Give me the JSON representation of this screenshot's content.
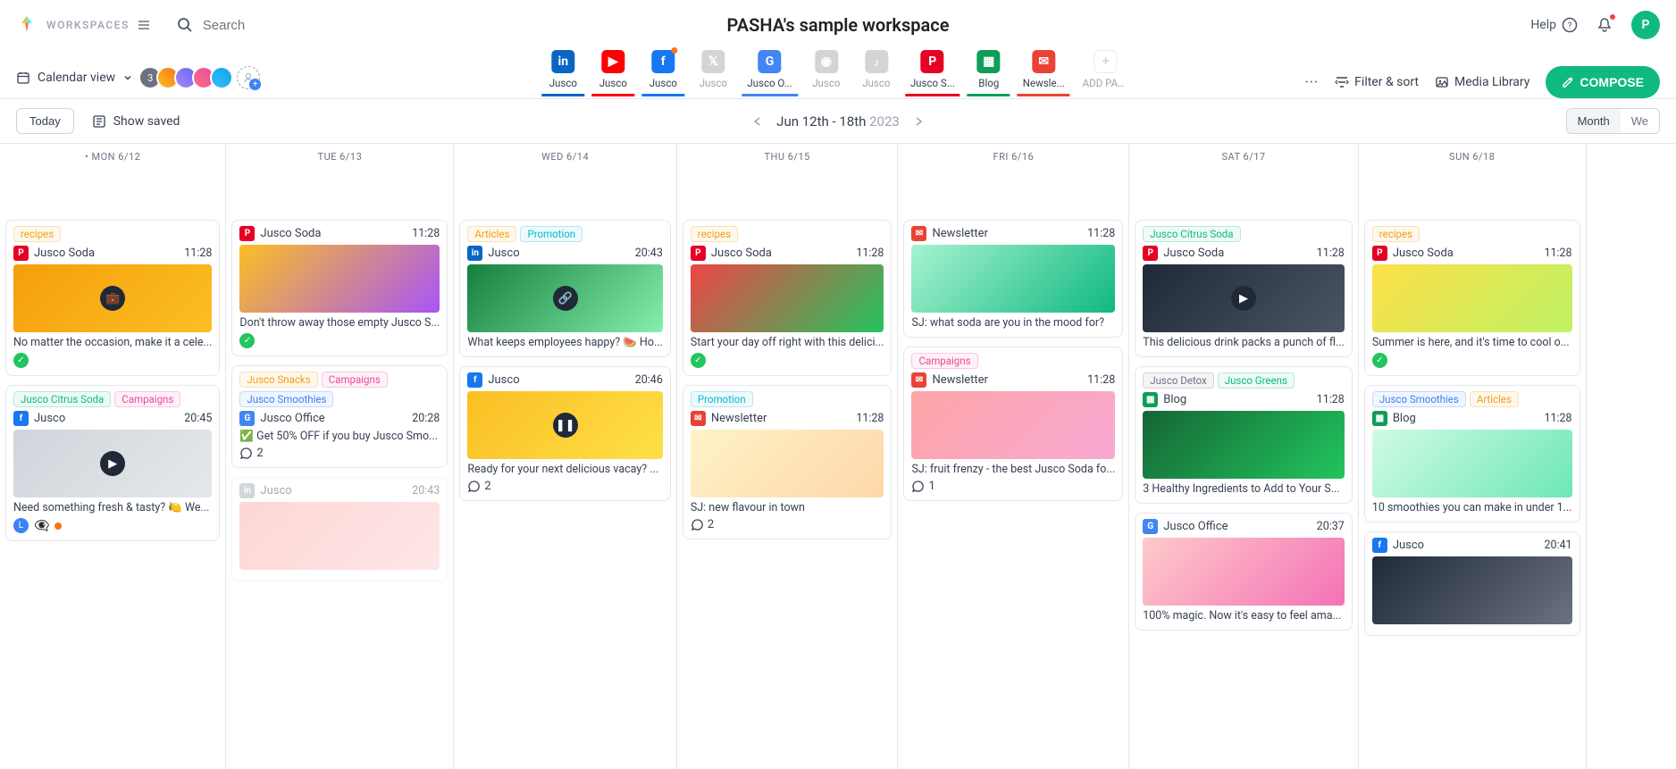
{
  "header": {
    "workspaces_label": "WORKSPACES",
    "search_placeholder": "Search",
    "title": "PASHA's sample workspace",
    "help_label": "Help",
    "avatar_initial": "P"
  },
  "toolbar": {
    "view_label": "Calendar view",
    "avatar_count": "3",
    "filter_sort": "Filter & sort",
    "media_library": "Media Library",
    "compose": "COMPOSE",
    "add_pages": "ADD PAGES"
  },
  "pages": [
    {
      "label": "Jusco",
      "network": "linkedin",
      "color": "#0a66c2",
      "active": true
    },
    {
      "label": "Jusco",
      "network": "youtube",
      "color": "#ff0000",
      "active": true
    },
    {
      "label": "Jusco",
      "network": "facebook",
      "color": "#1877f2",
      "active": true,
      "dot": true
    },
    {
      "label": "Jusco",
      "network": "twitter",
      "color": "#9ca3af",
      "active": false
    },
    {
      "label": "Jusco O...",
      "network": "google",
      "color": "#4285f4",
      "active": true
    },
    {
      "label": "Jusco",
      "network": "instagram",
      "color": "#9ca3af",
      "active": false
    },
    {
      "label": "Jusco",
      "network": "tiktok",
      "color": "#9ca3af",
      "active": false
    },
    {
      "label": "Jusco S...",
      "network": "pinterest",
      "color": "#e60023",
      "active": true
    },
    {
      "label": "Blog",
      "network": "sheets",
      "color": "#0f9d58",
      "active": true
    },
    {
      "label": "Newsle...",
      "network": "gmail",
      "color": "#ea4335",
      "active": true
    }
  ],
  "subbar": {
    "today": "Today",
    "show_saved": "Show saved",
    "date_range": "Jun 12th - 18th",
    "year": "2023",
    "month_label": "Month",
    "week_label": "We"
  },
  "days": [
    {
      "label": "MON 6/12",
      "today": true
    },
    {
      "label": "TUE 6/13"
    },
    {
      "label": "WED 6/14"
    },
    {
      "label": "THU 6/15"
    },
    {
      "label": "FRI 6/16"
    },
    {
      "label": "SAT 6/17"
    },
    {
      "label": "SUN 6/18"
    }
  ],
  "cards": {
    "mon": [
      {
        "tags": [
          {
            "t": "recipes",
            "c": "#f59e0b"
          }
        ],
        "icon": "pinterest",
        "icolor": "#e60023",
        "source": "Jusco Soda",
        "time": "11:28",
        "thumb": "linear-gradient(135deg,#f59e0b,#fbbf24)",
        "overlay": "briefcase",
        "text": "No matter the occasion, make it a cele...",
        "status": "check"
      },
      {
        "tags": [
          {
            "t": "Jusco Citrus Soda",
            "c": "#10b981"
          },
          {
            "t": "Campaigns",
            "c": "#ec4899"
          }
        ],
        "icon": "facebook",
        "icolor": "#1877f2",
        "source": "Jusco",
        "time": "20:45",
        "thumb": "linear-gradient(135deg,#d1d5db,#e5e7eb)",
        "overlay": "play",
        "text": "Need something fresh & tasty? 🍋 We...",
        "icons_row": [
          "L",
          "eye",
          "dot"
        ]
      }
    ],
    "tue": [
      {
        "tags": [],
        "icon": "pinterest",
        "icolor": "#e60023",
        "source": "Jusco Soda",
        "time": "11:28",
        "thumb": "linear-gradient(135deg,#fbbf24,#a855f7)",
        "text": "Don't throw away those empty Jusco S...",
        "status": "check"
      },
      {
        "tags": [
          {
            "t": "Jusco Snacks",
            "c": "#f59e0b"
          },
          {
            "t": "Campaigns",
            "c": "#ec4899"
          },
          {
            "t": "Jusco Smoothies",
            "c": "#3b82f6"
          }
        ],
        "icon": "google",
        "icolor": "#4285f4",
        "source": "Jusco Office",
        "time": "20:28",
        "text": "✅ Get 50% OFF if you buy Jusco Smo...",
        "comments": "2"
      },
      {
        "faded": true,
        "tags": [],
        "icon": "linkedin",
        "icolor": "#9ca3af",
        "source": "Jusco",
        "time": "20:43",
        "thumb": "linear-gradient(135deg,#fca5a5,#fecaca)"
      }
    ],
    "wed": [
      {
        "tags": [
          {
            "t": "Articles",
            "c": "#f59e0b"
          },
          {
            "t": "Promotion",
            "c": "#06b6d4"
          }
        ],
        "icon": "linkedin",
        "icolor": "#0a66c2",
        "source": "Jusco",
        "time": "20:43",
        "thumb": "linear-gradient(135deg,#15803d,#86efac)",
        "overlay": "link",
        "text": "What keeps employees happy? 🍉 Ho..."
      },
      {
        "tags": [],
        "icon": "facebook",
        "icolor": "#1877f2",
        "source": "Jusco",
        "time": "20:46",
        "thumb": "linear-gradient(135deg,#fbbf24,#fde047)",
        "overlay": "pause",
        "text": "Ready for your next delicious vacay? ...",
        "comments": "2"
      }
    ],
    "thu": [
      {
        "tags": [
          {
            "t": "recipes",
            "c": "#f59e0b"
          }
        ],
        "icon": "pinterest",
        "icolor": "#e60023",
        "source": "Jusco Soda",
        "time": "11:28",
        "thumb": "linear-gradient(135deg,#ef4444,#22c55e)",
        "text": "Start your day off right with this delici...",
        "status": "check"
      },
      {
        "tags": [
          {
            "t": "Promotion",
            "c": "#06b6d4"
          }
        ],
        "icon": "gmail",
        "icolor": "#ea4335",
        "source": "Newsletter",
        "time": "11:28",
        "thumb": "linear-gradient(135deg,#fef3c7,#fed7aa)",
        "text": "SJ: new flavour in town",
        "comments": "2"
      }
    ],
    "fri": [
      {
        "tags": [],
        "icon": "gmail",
        "icolor": "#ea4335",
        "source": "Newsletter",
        "time": "11:28",
        "thumb": "linear-gradient(135deg,#a7f3d0,#10b981)",
        "text": "SJ: what soda are you in the mood for?"
      },
      {
        "tags": [
          {
            "t": "Campaigns",
            "c": "#ec4899"
          }
        ],
        "icon": "gmail",
        "icolor": "#ea4335",
        "source": "Newsletter",
        "time": "11:28",
        "thumb": "linear-gradient(135deg,#fca5a5,#f9a8d4)",
        "text": "SJ: fruit frenzy - the best Jusco Soda fo...",
        "comments": "1"
      }
    ],
    "sat": [
      {
        "tags": [
          {
            "t": "Jusco Citrus Soda",
            "c": "#10b981"
          }
        ],
        "icon": "pinterest",
        "icolor": "#e60023",
        "source": "Jusco Soda",
        "time": "11:28",
        "thumb": "linear-gradient(135deg,#1f2937,#4b5563)",
        "overlay": "play",
        "text": "This delicious drink packs a punch of fl..."
      },
      {
        "tags": [
          {
            "t": "Jusco Detox",
            "c": "#6b7280"
          },
          {
            "t": "Jusco Greens",
            "c": "#10b981"
          }
        ],
        "icon": "sheets",
        "icolor": "#0f9d58",
        "source": "Blog",
        "time": "11:28",
        "thumb": "linear-gradient(135deg,#166534,#22c55e)",
        "text": "3 Healthy Ingredients to Add to Your S..."
      },
      {
        "tags": [],
        "icon": "google",
        "icolor": "#4285f4",
        "source": "Jusco Office",
        "time": "20:37",
        "thumb": "linear-gradient(135deg,#fecaca,#f472b6)",
        "text": "100% magic. Now it's easy to feel ama..."
      }
    ],
    "sun": [
      {
        "tags": [
          {
            "t": "recipes",
            "c": "#f59e0b"
          }
        ],
        "icon": "pinterest",
        "icolor": "#e60023",
        "source": "Jusco Soda",
        "time": "11:28",
        "thumb": "linear-gradient(135deg,#fde047,#bef264)",
        "text": "Summer is here, and it's time to cool o...",
        "status": "check"
      },
      {
        "tags": [
          {
            "t": "Jusco Smoothies",
            "c": "#3b82f6"
          },
          {
            "t": "Articles",
            "c": "#f59e0b"
          }
        ],
        "icon": "sheets",
        "icolor": "#0f9d58",
        "source": "Blog",
        "time": "11:28",
        "thumb": "linear-gradient(135deg,#d1fae5,#6ee7b7)",
        "text": "10 smoothies you can make in under 1..."
      },
      {
        "tags": [],
        "icon": "facebook",
        "icolor": "#1877f2",
        "source": "Jusco",
        "time": "20:41",
        "thumb": "linear-gradient(135deg,#1f2937,#6b7280)"
      }
    ]
  }
}
